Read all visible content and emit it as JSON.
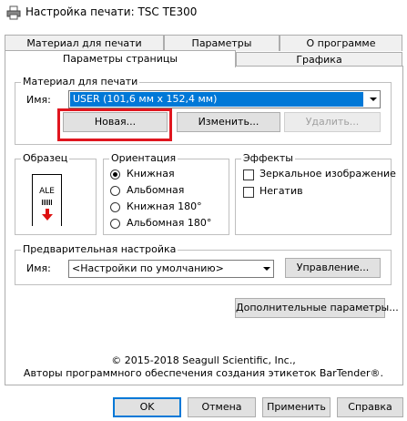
{
  "window": {
    "title": "Настройка печати: TSC TE300"
  },
  "tabs": {
    "row1": [
      "Материал для печати",
      "Параметры",
      "О программе"
    ],
    "row2": [
      "Параметры страницы",
      "Графика"
    ]
  },
  "stock": {
    "group_label": "Материал для печати",
    "name_label": "Имя:",
    "name_value": "USER (101,6 мм x 152,4 мм)",
    "new_button": "Новая...",
    "edit_button": "Изменить...",
    "delete_button": "Удалить..."
  },
  "preview": {
    "group_label": "Образец",
    "sample_text": "ALE"
  },
  "orientation": {
    "group_label": "Ориентация",
    "options": [
      "Книжная",
      "Альбомная",
      "Книжная 180°",
      "Альбомная 180°"
    ],
    "selected": "Книжная"
  },
  "effects": {
    "group_label": "Эффекты",
    "options": [
      "Зеркальное изображение",
      "Негатив"
    ]
  },
  "preset": {
    "group_label": "Предварительная настройка",
    "name_label": "Имя:",
    "name_value": "<Настройки по умолчанию>",
    "manage_button": "Управление..."
  },
  "advanced_button": "Дополнительные параметры...",
  "footer": {
    "copyright": "© 2015-2018 Seagull Scientific, Inc.,",
    "authors": "Авторы программного обеспечения создания этикеток BarTender®."
  },
  "buttons": {
    "ok": "OK",
    "cancel": "Отмена",
    "apply": "Применить",
    "help": "Справка"
  },
  "colors": {
    "selection": "#0078d7",
    "highlight": "#e0161f"
  }
}
